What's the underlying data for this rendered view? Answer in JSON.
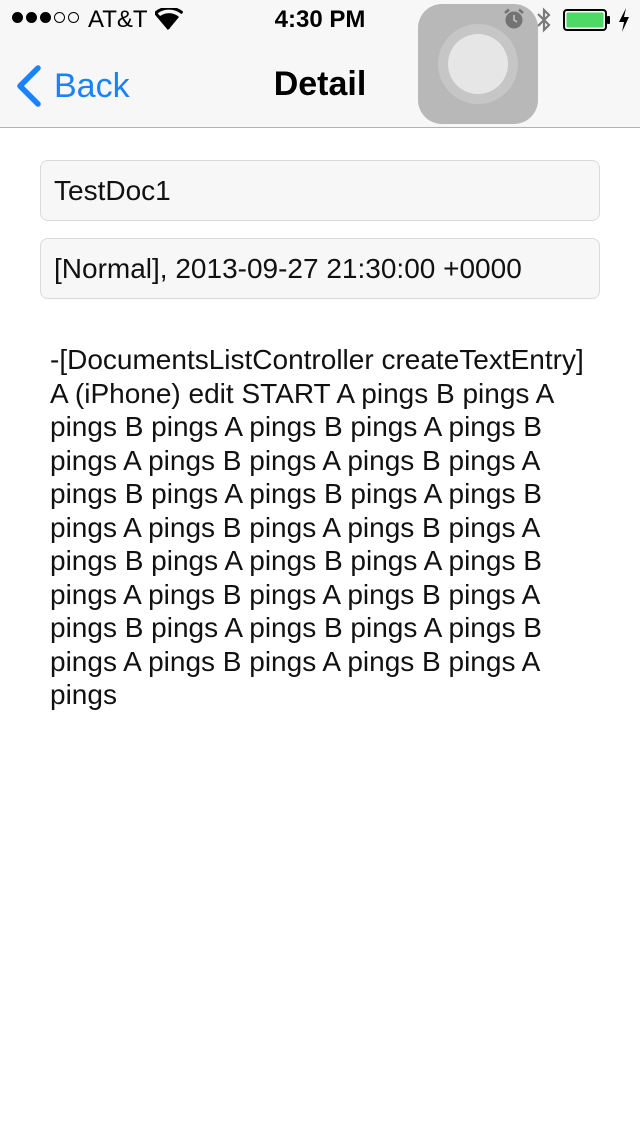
{
  "status_bar": {
    "carrier": "AT&T",
    "time": "4:30 PM",
    "signal_bars_filled": 3,
    "signal_bars_total": 5,
    "battery_level_percent": 100,
    "battery_color": "#4cd964",
    "icons": [
      "wifi-icon",
      "alarm-icon",
      "bluetooth-icon",
      "battery-icon",
      "charging-icon"
    ]
  },
  "nav": {
    "back_label": "Back",
    "title": "Detail",
    "accent_color": "#1a82fb"
  },
  "document": {
    "title": "TestDoc1",
    "meta": "[Normal], 2013-09-27 21:30:00 +0000",
    "body": "-[DocumentsListController createTextEntry]\nA (iPhone) edit START A pings B pings A pings B pings A pings B pings A pings B pings A pings B pings A pings B pings A pings B pings A pings B pings A pings B pings A pings B pings A pings B pings A pings B pings A pings B pings A pings B pings A pings B pings A pings B pings A pings B pings A pings B pings A pings B pings A pings B pings A pings B pings A pings"
  }
}
